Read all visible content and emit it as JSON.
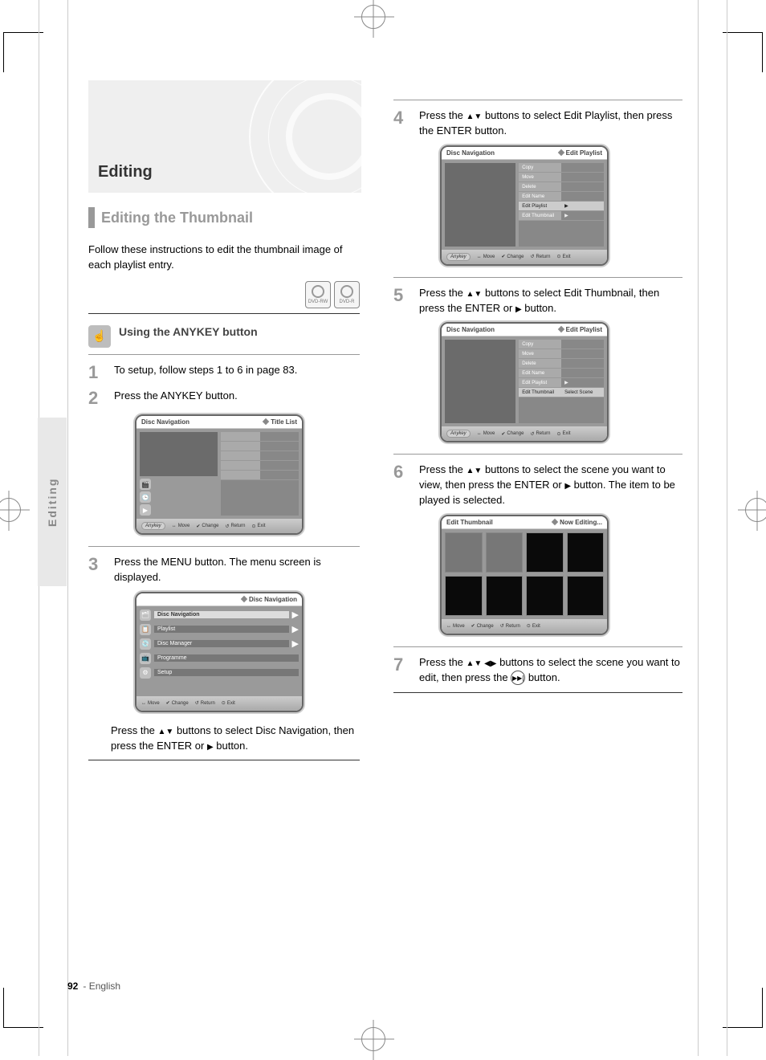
{
  "page": {
    "number": "92",
    "section": "- English",
    "side_tab": "Editing"
  },
  "hero": {
    "title": "Editing"
  },
  "section": {
    "title": "Editing the Thumbnail"
  },
  "icons": {
    "dvdrw": "DVD-RW",
    "dvdr": "DVD-R"
  },
  "left": {
    "intro": "Follow these instructions to edit the thumbnail image of each playlist entry.",
    "anykey_label": "Using the ANYKEY button",
    "s1_line1": "To setup, follow steps 1 to 6 in page 83.",
    "s2_line1": "Press the ANYKEY button.",
    "s3_line1": "Press the MENU button. The menu screen is displayed.",
    "s3_line2_a": "Press the ",
    "s3_line2_b": " buttons to select Disc Navigation, then press the ENTER or ",
    "s3_line2_c": " button."
  },
  "right": {
    "s4_a": "Press the ",
    "s4_b": " buttons to select Edit Playlist, then press the ENTER button.",
    "s5_a": "Press the ",
    "s5_b": " buttons to select Edit Thumbnail, then press the ENTER or ",
    "s5_c": " button.",
    "s6_a": "Press the ",
    "s6_b": " buttons to select the scene you want to view, then press the ENTER or ",
    "s6_c": " button. The item to be played is selected.",
    "s7_a": "Press the ",
    "s7_b": " buttons to select the scene you want to edit, then press the ",
    "s7_c": " button."
  },
  "screen": {
    "nav_title": "Disc Navigation",
    "playlist_label": "Playlist",
    "title_label": "Title List",
    "now_editing": "Now Editing...",
    "edit_pl": "Edit Playlist",
    "ep_copy": "Copy",
    "ep_move": "Move",
    "ep_del": "Delete",
    "ep_name": "Edit Name",
    "ep_pl": "Edit Playlist",
    "ep_thumb": "Edit Thumbnail",
    "ep_select": "Select Scene",
    "bottom_move": "Move",
    "bottom_chg": "Change",
    "bottom_ret": "Return",
    "bottom_exit": "Exit",
    "anykey": "Anykey"
  }
}
